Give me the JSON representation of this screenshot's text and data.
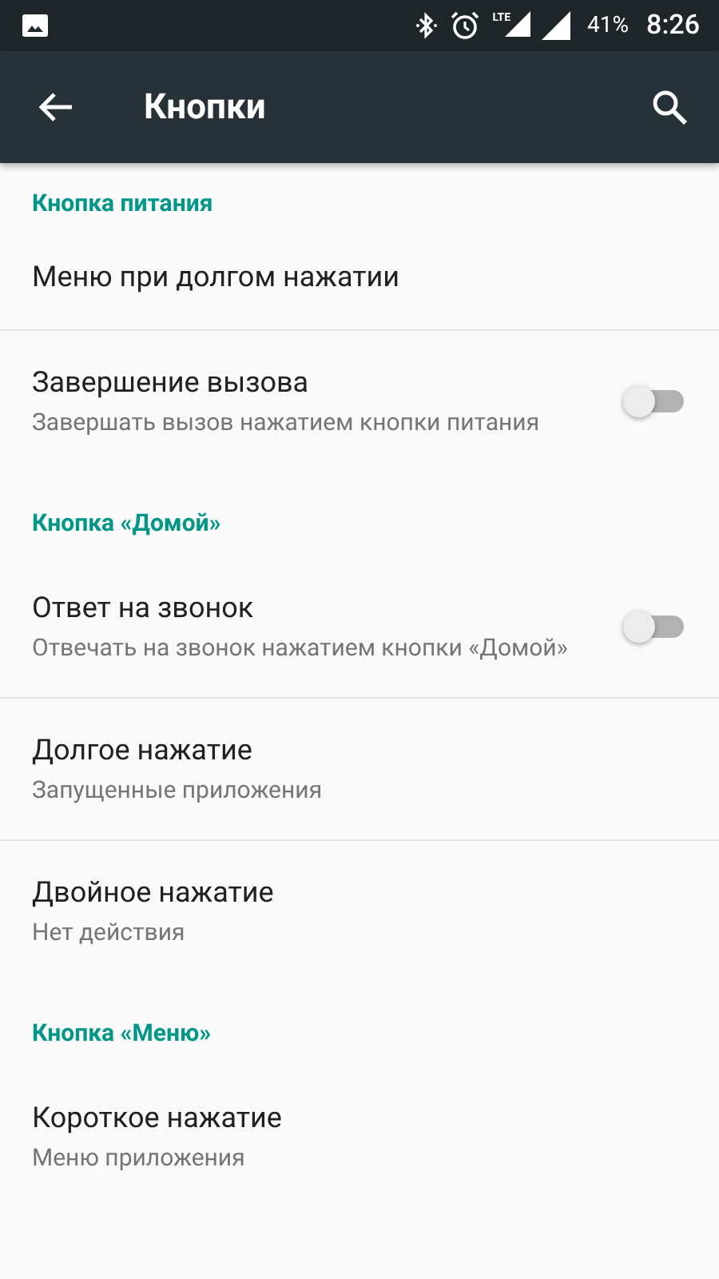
{
  "status_bar": {
    "network": "LTE",
    "battery": "41%",
    "time": "8:26"
  },
  "app_bar": {
    "title": "Кнопки"
  },
  "sections": [
    {
      "header": "Кнопка питания",
      "items": [
        {
          "kind": "plain",
          "title": "Меню при долгом нажатии"
        },
        {
          "kind": "switch",
          "title": "Завершение вызова",
          "summary": "Завершать вызов нажатием кнопки питания",
          "on": false
        }
      ]
    },
    {
      "header": "Кнопка «Домой»",
      "items": [
        {
          "kind": "switch",
          "title": "Ответ на звонок",
          "summary": "Отвечать на звонок нажатием кнопки «Домой»",
          "on": false
        },
        {
          "kind": "plain",
          "title": "Долгое нажатие",
          "summary": "Запущенные приложения"
        },
        {
          "kind": "plain",
          "title": "Двойное нажатие",
          "summary": "Нет действия"
        }
      ]
    },
    {
      "header": "Кнопка «Меню»",
      "items": [
        {
          "kind": "plain",
          "title": "Короткое нажатие",
          "summary": "Меню приложения"
        }
      ]
    }
  ]
}
